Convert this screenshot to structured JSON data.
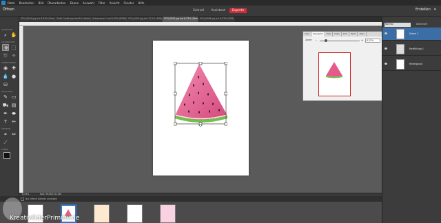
{
  "menubar": {
    "items": [
      "Datei",
      "Bearbeiten",
      "Bild",
      "Überarbeiten",
      "Ebene",
      "Auswahl",
      "Filter",
      "Ansicht",
      "Fenster",
      "Hilfe"
    ]
  },
  "modebar": {
    "open_label": "Öffnen",
    "modes": [
      "Schnell",
      "Assistent",
      "Experte"
    ],
    "active_mode": "Experte",
    "create_label": "Erstellen"
  },
  "doc_tabs": [
    {
      "label": "SCN_0004.jpg bei 8,33% (Ebene 1, RGB/8)",
      "active": false
    },
    {
      "label": "Gießl Grafik.psd bei 8% (Hintergrund, RGB/8)",
      "active": false
    },
    {
      "label": "Unbenannt-1 bei 8,33% (RGB/8)",
      "active": false
    },
    {
      "label": "SCN_0003.jpg bei 12,5% (RGB/8)",
      "active": false
    },
    {
      "label": "SCN_0005.jpg bei 8,33% (Ebene 1, RGB/8)",
      "active": true
    },
    {
      "label": "SCN_0006.jpg bei 8,33% (RGB/8)",
      "active": false
    }
  ],
  "toolbox": {
    "sections": [
      "ANZEIGEN",
      "AUSWÄHLEN",
      "VERBESSERN",
      "ZEICHNEN",
      "ÄNDERN",
      "FARBE"
    ]
  },
  "status": {
    "zoom": "8,33%",
    "docinfo": "Dok: 99,6M/111,6M"
  },
  "bin": {
    "show_open_label": "Nur offene Dateien anzeigen"
  },
  "watermark": "KreativOderPrimitiv.de",
  "navigator": {
    "tabs": [
      "Infos",
      "Navigator",
      "Farb",
      "Histo",
      "Prot",
      "Farbf",
      "Aktio"
    ],
    "active_tab": "Navigator",
    "zoom_label": "Zoom:",
    "zoom_value": "8,33%",
    "zoom_fraction": 0.15
  },
  "layers": {
    "blend_mode": "Normal",
    "opacity_label": "Deckkraft:",
    "items": [
      {
        "name": "Ebene 1",
        "active": true
      },
      {
        "name": "Farbfüllung 1",
        "active": false
      },
      {
        "name": "Hintergrund",
        "active": false
      }
    ]
  },
  "colors": {
    "accent_mode": "#c9303a",
    "selection_blue": "#3a6ea5",
    "nav_frame": "#c81e1e",
    "watermelon_pink": "#e65a8a",
    "rind_green": "#6fbf4a"
  }
}
